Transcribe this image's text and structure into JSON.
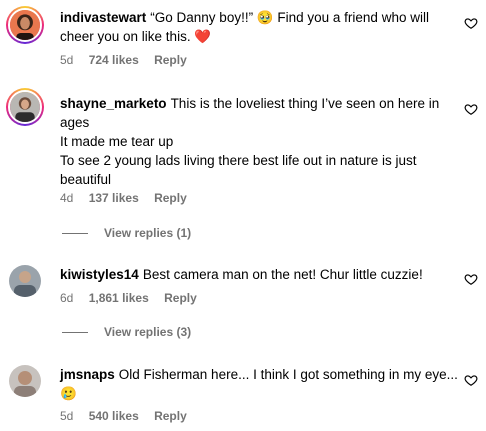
{
  "comments": [
    {
      "username": "indivastewart",
      "text_lines": [
        "“Go Danny boy!!” 🥹 Find you a friend who will cheer you on like this. ❤️"
      ],
      "time": "5d",
      "likes": "724 likes",
      "reply": "Reply"
    },
    {
      "username": "shayne_marketo",
      "text_lines": [
        "This is the loveliest thing I’ve seen on here in ages",
        "It made me tear up",
        "To see 2 young lads living there best life out in nature is just beautiful"
      ],
      "time": "4d",
      "likes": "137 likes",
      "reply": "Reply",
      "view_replies": "View replies (1)"
    },
    {
      "username": "kiwistyles14",
      "text_lines": [
        "Best camera man on the net! Chur little cuzzie!"
      ],
      "time": "6d",
      "likes": "1,861 likes",
      "reply": "Reply",
      "view_replies": "View replies (3)"
    },
    {
      "username": "jmsnaps",
      "text_lines": [
        "Old Fisherman here... I think I got something in my eye... 🥲"
      ],
      "time": "5d",
      "likes": "540 likes",
      "reply": "Reply"
    }
  ],
  "icons": {
    "like": "heart-outline-icon"
  },
  "colors": {
    "text": "#000000",
    "secondary": "#737373",
    "heart": "#ed2a55"
  }
}
